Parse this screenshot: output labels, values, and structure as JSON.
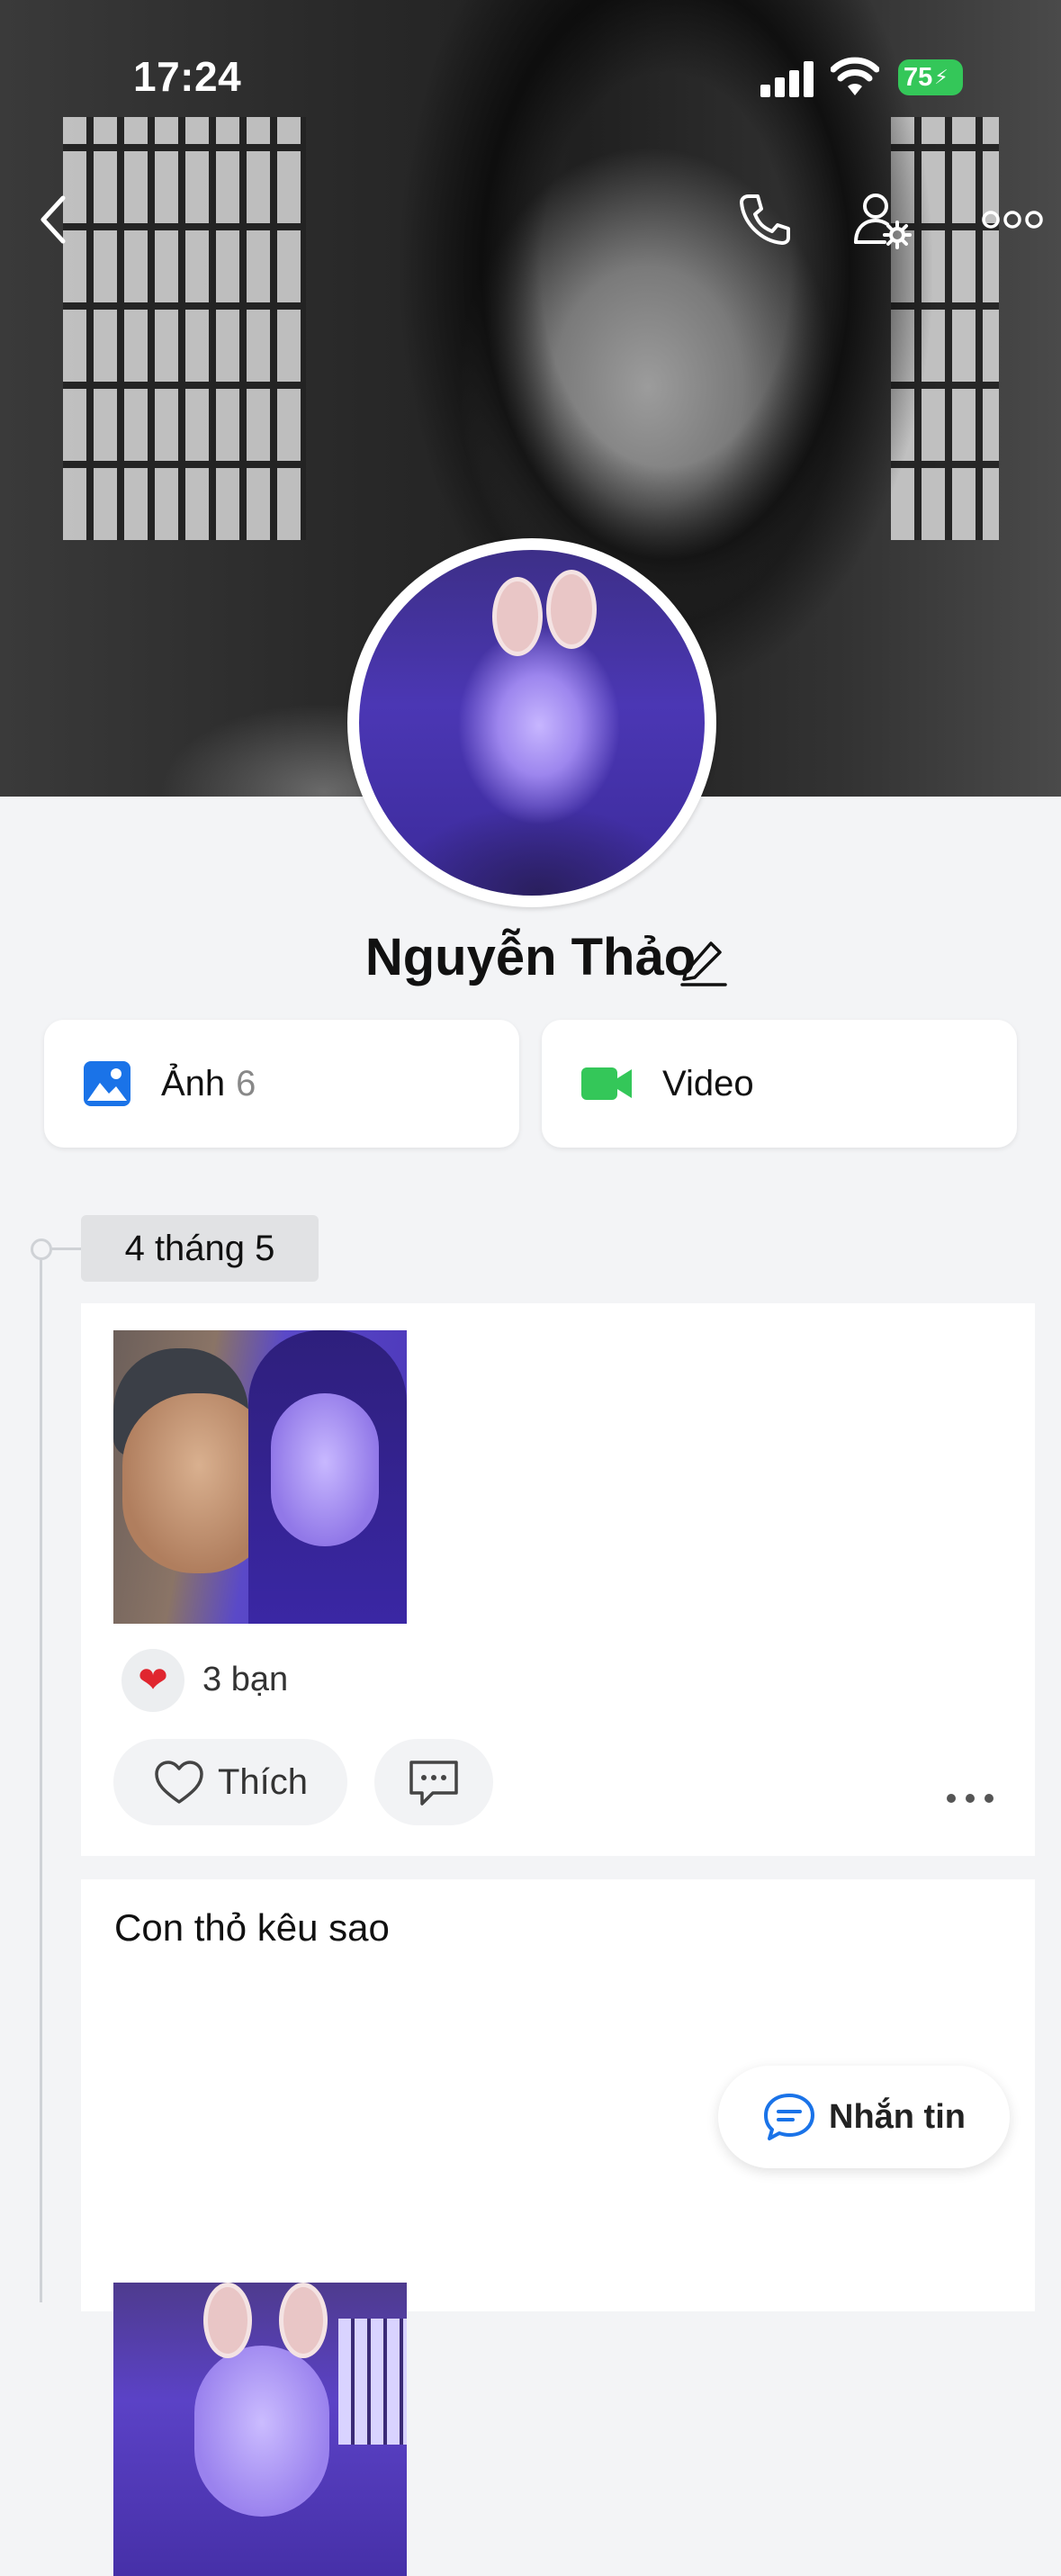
{
  "status_bar": {
    "time": "17:24",
    "battery": "75"
  },
  "header": {
    "back_icon": "chevron-left-icon",
    "call_icon": "phone-icon",
    "settings_icon": "user-settings-icon",
    "more_icon": "more-horizontal-icon"
  },
  "profile": {
    "name": "Nguyễn Thảo"
  },
  "media": {
    "photos_label": "Ảnh",
    "photos_count": "6",
    "video_label": "Video"
  },
  "timeline": {
    "date": "4 tháng 5",
    "posts": [
      {
        "reaction_count": "3 bạn",
        "like_label": "Thích"
      },
      {
        "caption": "Con thỏ kêu sao"
      }
    ]
  },
  "fab": {
    "label": "Nhắn tin"
  },
  "colors": {
    "accent_blue": "#1a73e8",
    "video_green": "#34c759",
    "heart_red": "#e0262f"
  }
}
